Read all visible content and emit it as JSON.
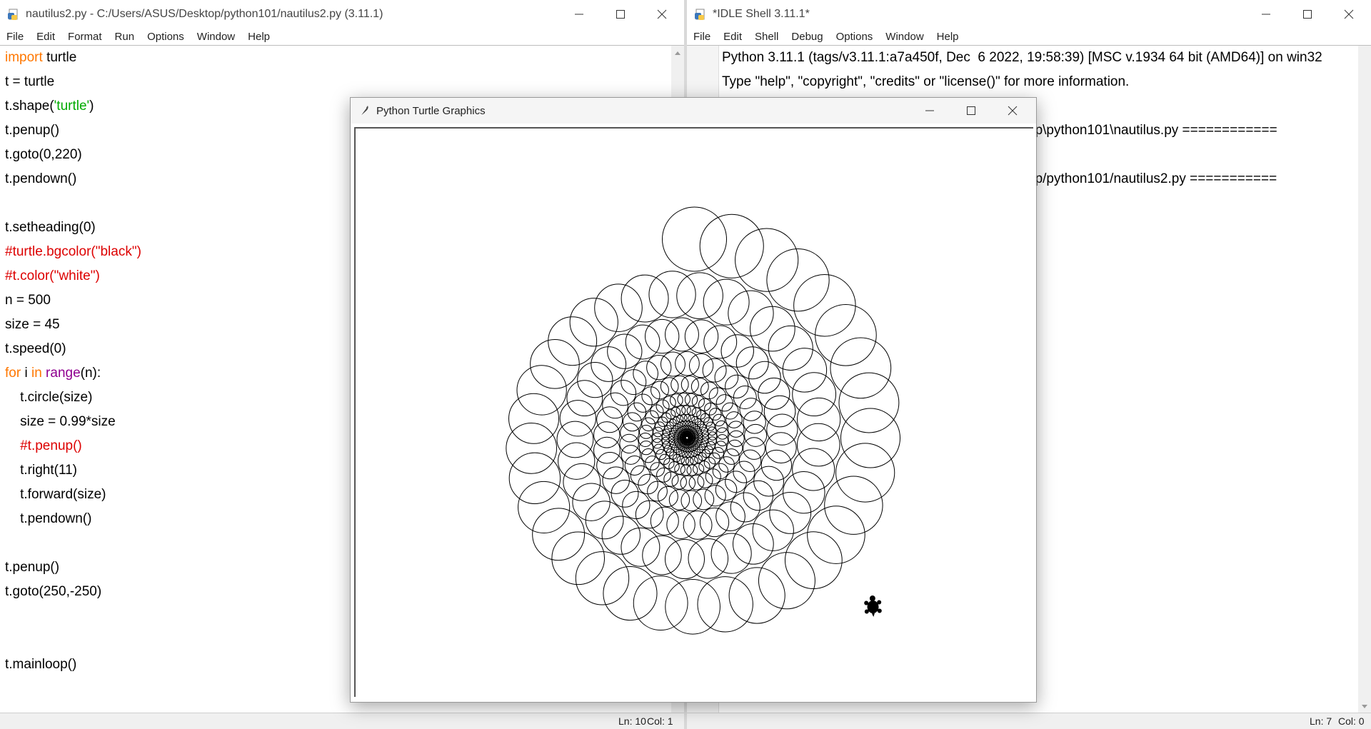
{
  "editor": {
    "title": "nautilus2.py - C:/Users/ASUS/Desktop/python101/nautilus2.py (3.11.1)",
    "menu": [
      "File",
      "Edit",
      "Format",
      "Run",
      "Options",
      "Window",
      "Help"
    ],
    "code_lines": [
      {
        "segments": [
          {
            "t": "import",
            "c": "kw"
          },
          {
            "t": " turtle",
            "c": ""
          }
        ]
      },
      {
        "segments": [
          {
            "t": "t = turtle",
            "c": ""
          }
        ]
      },
      {
        "segments": [
          {
            "t": "t.shape(",
            "c": ""
          },
          {
            "t": "'turtle'",
            "c": "str"
          },
          {
            "t": ")",
            "c": ""
          }
        ]
      },
      {
        "segments": [
          {
            "t": "t.penup()",
            "c": ""
          }
        ]
      },
      {
        "segments": [
          {
            "t": "t.goto(0,220)",
            "c": ""
          }
        ]
      },
      {
        "segments": [
          {
            "t": "t.pendown()",
            "c": ""
          }
        ]
      },
      {
        "segments": []
      },
      {
        "segments": [
          {
            "t": "t.setheading(0)",
            "c": ""
          }
        ]
      },
      {
        "segments": [
          {
            "t": "#turtle.bgcolor(\"black\")",
            "c": "cmt"
          }
        ]
      },
      {
        "segments": [
          {
            "t": "#t.color(\"white\")",
            "c": "cmt"
          }
        ]
      },
      {
        "segments": [
          {
            "t": "n = 500",
            "c": ""
          }
        ]
      },
      {
        "segments": [
          {
            "t": "size = 45",
            "c": ""
          }
        ]
      },
      {
        "segments": [
          {
            "t": "t.speed(0)",
            "c": ""
          }
        ]
      },
      {
        "segments": [
          {
            "t": "for",
            "c": "kw"
          },
          {
            "t": " i ",
            "c": ""
          },
          {
            "t": "in",
            "c": "kw"
          },
          {
            "t": " ",
            "c": ""
          },
          {
            "t": "range",
            "c": "bi"
          },
          {
            "t": "(n):",
            "c": ""
          }
        ]
      },
      {
        "segments": [
          {
            "t": "    t.circle(size)",
            "c": ""
          }
        ]
      },
      {
        "segments": [
          {
            "t": "    size = 0.99*size",
            "c": ""
          }
        ]
      },
      {
        "segments": [
          {
            "t": "    #t.penup()",
            "c": "cmt"
          }
        ]
      },
      {
        "segments": [
          {
            "t": "    t.right(11)",
            "c": ""
          }
        ]
      },
      {
        "segments": [
          {
            "t": "    t.forward(size)",
            "c": ""
          }
        ]
      },
      {
        "segments": [
          {
            "t": "    t.pendown()",
            "c": ""
          }
        ]
      },
      {
        "segments": []
      },
      {
        "segments": [
          {
            "t": "t.penup()",
            "c": ""
          }
        ]
      },
      {
        "segments": [
          {
            "t": "t.goto(250,-250)",
            "c": ""
          }
        ]
      },
      {
        "segments": []
      },
      {
        "segments": []
      },
      {
        "segments": [
          {
            "t": "t.mainloop()",
            "c": ""
          }
        ]
      }
    ],
    "status_ln": "Ln: 10",
    "status_col": "Col: 1"
  },
  "shell": {
    "title": "*IDLE Shell 3.11.1*",
    "menu": [
      "File",
      "Edit",
      "Shell",
      "Debug",
      "Options",
      "Window",
      "Help"
    ],
    "line1": "Python 3.11.1 (tags/v3.11.1:a7a450f, Dec  6 2022, 19:58:39) [MSC v.1934 64 bit (AMD64)] on win32",
    "line2": "Type \"help\", \"copyright\", \"credits\" or \"license()\" for more information.",
    "line3": "op\\python101\\nautilus.py ============",
    "line4": "op/python101/nautilus2.py ===========",
    "status_ln": "Ln: 7",
    "status_col": "Col: 0"
  },
  "turtle": {
    "title": "Python Turtle Graphics",
    "n": 500,
    "start_size": 45,
    "decay": 0.99,
    "turn": 11,
    "start": [
      0,
      220
    ],
    "turtle_pos": [
      250,
      -250
    ]
  },
  "colors": {
    "keyword": "#ff7700",
    "string": "#00aa00",
    "comment": "#dd0000",
    "builtin": "#900090"
  },
  "icons": [
    "idle-file-icon",
    "feather-icon",
    "minimize-icon",
    "maximize-icon",
    "close-icon"
  ]
}
